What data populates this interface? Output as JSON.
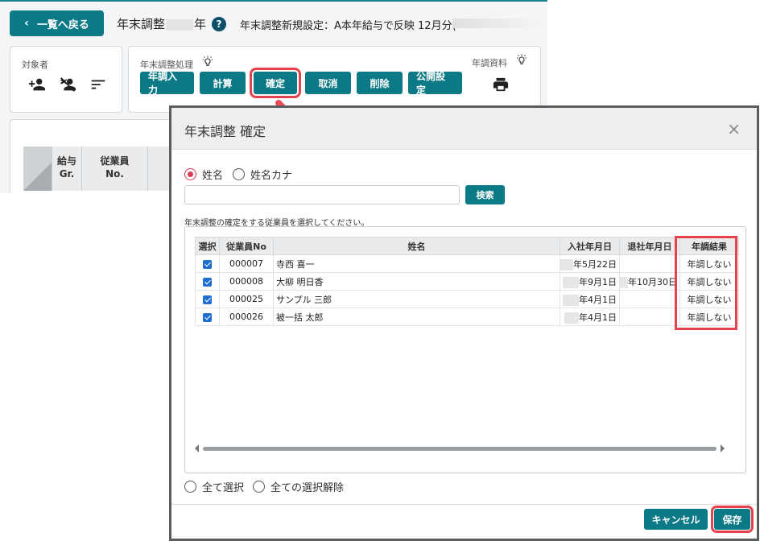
{
  "header": {
    "back_label": "一覧へ戻る",
    "title_pre": "年末調整",
    "title_post": "年",
    "setting_text": "年末調整新規設定：A本年給与で反映 12月分("
  },
  "target_panel": {
    "label": "対象者"
  },
  "process_panel": {
    "label": "年末調整処理",
    "buttons": [
      "年調入力",
      "計算",
      "確定",
      "取消",
      "削除",
      "公開設定"
    ],
    "docs_label": "年調資料"
  },
  "bg_table": {
    "headers": [
      [
        "給与",
        "Gr."
      ],
      [
        "従業員",
        "No."
      ]
    ]
  },
  "dialog": {
    "title": "年末調整 確定",
    "radio_name": "姓名",
    "radio_kana": "姓名カナ",
    "search_value": "",
    "search_button": "検索",
    "instruction": "年末調整の確定をする従業員を選択してください。",
    "columns": [
      "選択",
      "従業員No",
      "姓名",
      "入社年月日",
      "退社年月日",
      "年調結果"
    ],
    "rows": [
      {
        "no": "000007",
        "name": "寺西 喜一",
        "join": "年5月22日",
        "leave": "",
        "result": "年調しない"
      },
      {
        "no": "000008",
        "name": "大柳 明日香",
        "join": "年9月1日",
        "leave": "年10月30日",
        "result": "年調しない"
      },
      {
        "no": "000025",
        "name": "サンプル 三郎",
        "join": "年4月1日",
        "leave": "",
        "result": "年調しない"
      },
      {
        "no": "000026",
        "name": "被一括 太郎",
        "join": "年4月1日",
        "leave": "",
        "result": "年調しない"
      }
    ],
    "select_all": "全て選択",
    "deselect_all": "全ての選択解除",
    "cancel_label": "キャンセル",
    "save_label": "保存"
  },
  "colors": {
    "primary": "#0b7a86",
    "highlight": "#e5424d",
    "radio_active": "#d93a56"
  }
}
